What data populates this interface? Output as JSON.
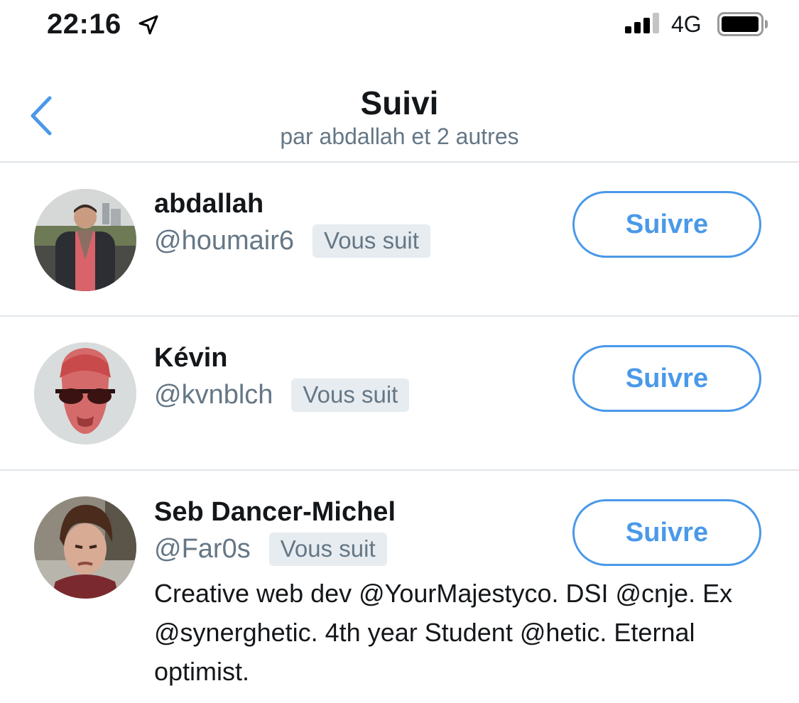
{
  "status_bar": {
    "time": "22:16",
    "network": "4G",
    "icons": [
      "location-arrow-icon",
      "cellular-signal-icon",
      "battery-icon"
    ]
  },
  "header": {
    "back_icon": "chevron-left-icon",
    "title": "Suivi",
    "subtitle": "par abdallah et 2 autres"
  },
  "accent_color": "#4a99e9",
  "users": [
    {
      "name": "abdallah",
      "handle": "@houmair6",
      "badge": "Vous suit",
      "button_label": "Suivre"
    },
    {
      "name": "Kévin",
      "handle": "@kvnblch",
      "badge": "Vous suit",
      "button_label": "Suivre"
    },
    {
      "name": "Seb Dancer-Michel",
      "handle": "@Far0s",
      "badge": "Vous suit",
      "button_label": "Suivre",
      "bio": "Creative web dev @YourMajestyco. DSI @cnje. Ex @synerghetic. 4th year Student @hetic. Eternal optimist."
    }
  ]
}
